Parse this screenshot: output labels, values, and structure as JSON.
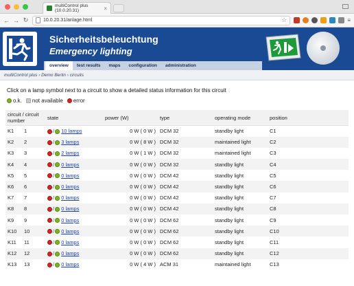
{
  "browser": {
    "tab_title": "multiControl plus (10.0.20.31)",
    "url": "10.0.20.31/anlage.html"
  },
  "header": {
    "title": "Sicherheitsbeleuchtung",
    "subtitle": "Emergency lighting"
  },
  "menu": [
    "overview",
    "test results",
    "maps",
    "configuration",
    "administration"
  ],
  "breadcrumb": "multiControl plus › Demo Berlin › circuits",
  "intro": "Click on a lamp symbol next to a circuit to show a detailed status information for this circuit",
  "legend": {
    "ok": "o.k.",
    "na": "not available",
    "error": "error"
  },
  "table": {
    "headers": {
      "circuit": "circuit / circuit number",
      "state": "state",
      "power": "power (W)",
      "type": "type",
      "mode": "operating mode",
      "position": "position"
    },
    "rows": [
      {
        "k": "K1",
        "n": "1",
        "lamps": "10 lamps",
        "power": "0 W ( 0 W )",
        "type": "DCM 32",
        "mode": "standby light",
        "pos": "C1"
      },
      {
        "k": "K2",
        "n": "2",
        "lamps": "3 lamps",
        "power": "0 W ( 8 W )",
        "type": "DCM 32",
        "mode": "maintained light",
        "pos": "C2"
      },
      {
        "k": "K3",
        "n": "3",
        "lamps": "2 lamps",
        "power": "0 W ( 1 W )",
        "type": "DCM 32",
        "mode": "maintained light",
        "pos": "C3"
      },
      {
        "k": "K4",
        "n": "4",
        "lamps": "0 lamps",
        "power": "0 W ( 0 W )",
        "type": "DCM 32",
        "mode": "standby light",
        "pos": "C4"
      },
      {
        "k": "K5",
        "n": "5",
        "lamps": "0 lamps",
        "power": "0 W ( 0 W )",
        "type": "DCM 42",
        "mode": "standby light",
        "pos": "C5"
      },
      {
        "k": "K6",
        "n": "6",
        "lamps": "0 lamps",
        "power": "0 W ( 0 W )",
        "type": "DCM 42",
        "mode": "standby light",
        "pos": "C6"
      },
      {
        "k": "K7",
        "n": "7",
        "lamps": "0 lamps",
        "power": "0 W ( 0 W )",
        "type": "DCM 42",
        "mode": "standby light",
        "pos": "C7"
      },
      {
        "k": "K8",
        "n": "8",
        "lamps": "0 lamps",
        "power": "0 W ( 0 W )",
        "type": "DCM 42",
        "mode": "standby light",
        "pos": "C8"
      },
      {
        "k": "K9",
        "n": "9",
        "lamps": "0 lamps",
        "power": "0 W ( 0 W )",
        "type": "DCM 62",
        "mode": "standby light",
        "pos": "C9"
      },
      {
        "k": "K10",
        "n": "10",
        "lamps": "0 lamps",
        "power": "0 W ( 0 W )",
        "type": "DCM 62",
        "mode": "standby light",
        "pos": "C10"
      },
      {
        "k": "K11",
        "n": "11",
        "lamps": "0 lamps",
        "power": "0 W ( 0 W )",
        "type": "DCM 62",
        "mode": "standby light",
        "pos": "C11"
      },
      {
        "k": "K12",
        "n": "12",
        "lamps": "0 lamps",
        "power": "0 W ( 0 W )",
        "type": "DCM 62",
        "mode": "standby light",
        "pos": "C12"
      },
      {
        "k": "K13",
        "n": "13",
        "lamps": "0 lamps",
        "power": "0 W ( 4 W )",
        "type": "ACM 31",
        "mode": "maintained light",
        "pos": "C13"
      }
    ]
  },
  "colors": {
    "header_blue": "#1a4a93",
    "ok_green": "#7cb518",
    "error_red": "#d32626",
    "link_blue": "#1a3fb0"
  },
  "icons": {
    "ok": "green-lamp-icon",
    "error": "red-lamp-icon",
    "na": "grey-square-icon"
  }
}
